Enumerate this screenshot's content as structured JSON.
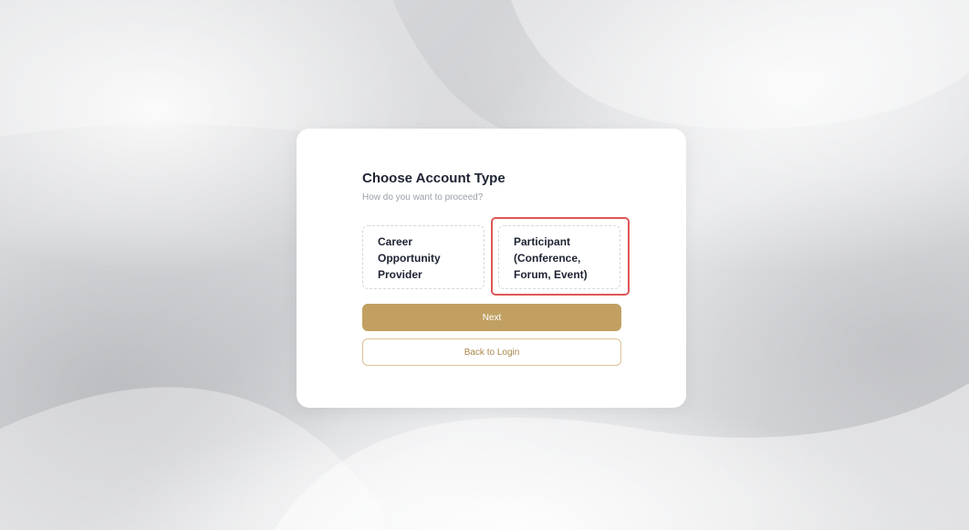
{
  "account_type": {
    "title": "Choose Account Type",
    "subtitle": "How do you want to proceed?",
    "options": [
      {
        "label": "Career Opportunity Provider"
      },
      {
        "label": "Participant (Conference, Forum, Event)"
      }
    ],
    "next_label": "Next",
    "back_label": "Back to Login"
  },
  "colors": {
    "accent": "#c1a062",
    "highlight": "#e05656",
    "title": "#1d2333",
    "subtitle": "#9aa0aa"
  }
}
